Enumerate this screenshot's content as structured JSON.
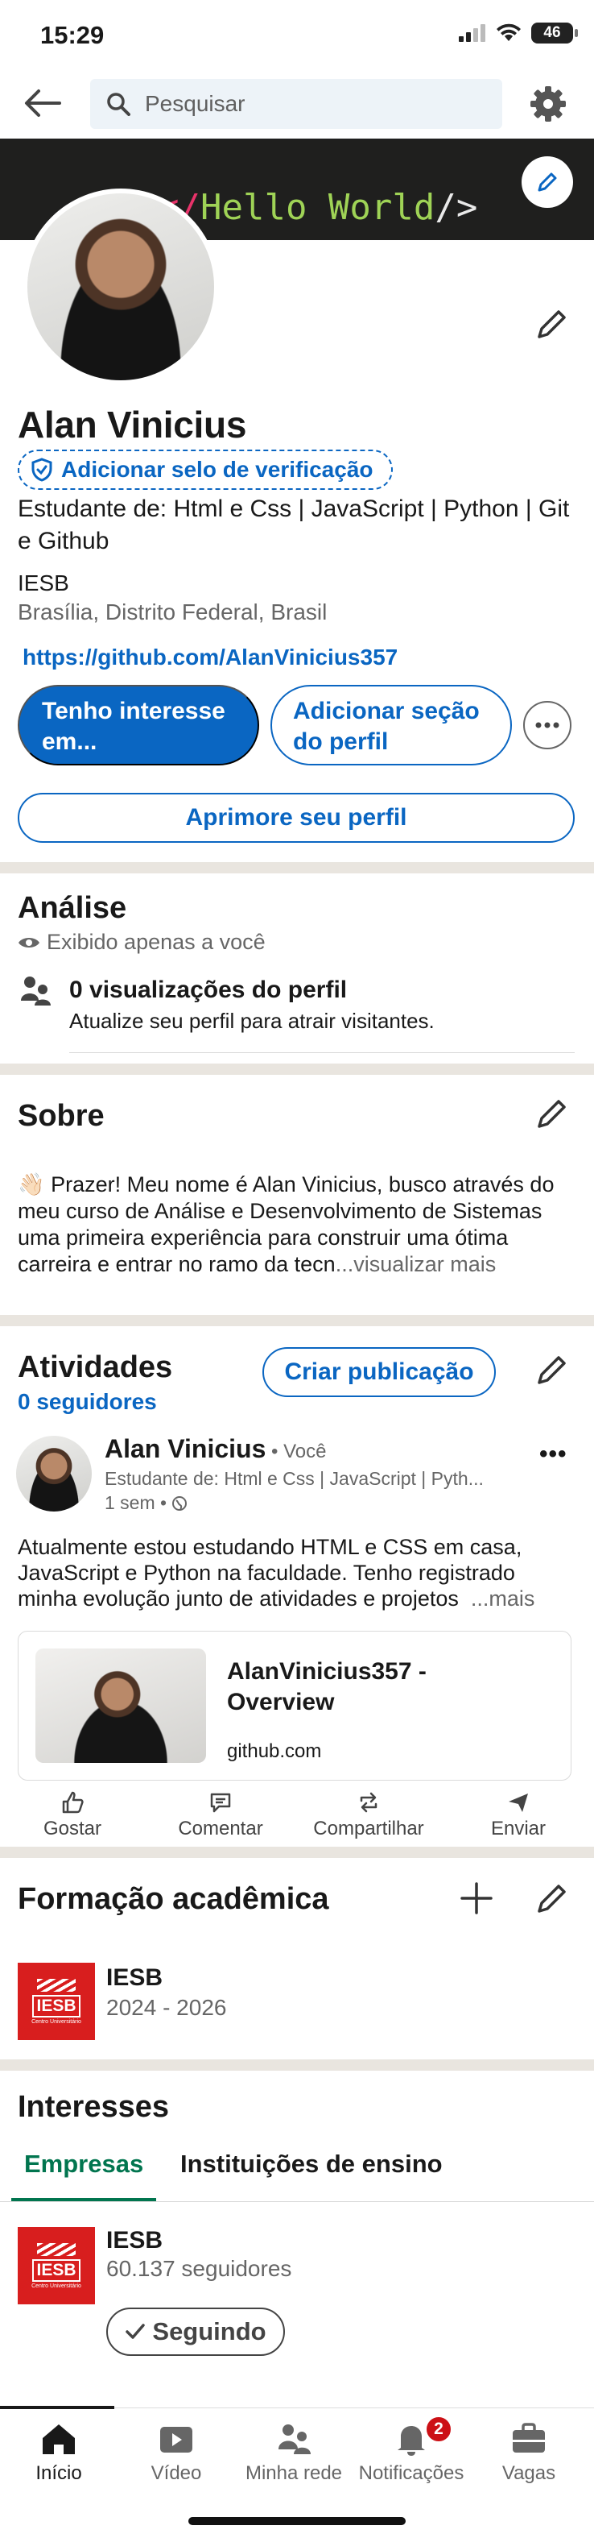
{
  "status_bar": {
    "time": "15:29",
    "battery": "46"
  },
  "top_nav": {
    "search_placeholder": "Pesquisar"
  },
  "cover": {
    "code_open": "</",
    "code_mid": "Hello World",
    "code_close": "/>"
  },
  "profile": {
    "name": "Alan Vinicius",
    "verify_label": "Adicionar selo de verificação",
    "headline": "Estudante de: Html e Css | JavaScript | Python | Git e Github",
    "education": "IESB",
    "location": "Brasília, Distrito Federal, Brasil",
    "link": "https://github.com/AlanVinicius357",
    "open_to_button": "Tenho interesse em...",
    "add_section_button": "Adicionar seção do perfil",
    "enhance_button": "Aprimore seu perfil"
  },
  "analytics": {
    "title": "Análise",
    "private_note": "Exibido apenas a você",
    "views_title": "0 visualizações do perfil",
    "views_desc": "Atualize seu perfil para atrair visitantes."
  },
  "about": {
    "title": "Sobre",
    "text": "👋🏻 Prazer! Meu nome é Alan Vinicius, busco através do meu curso de Análise e Desenvolvimento de Sistemas uma primeira experiência para construir uma ótima carreira e entrar no ramo da tecn",
    "see_more": "...visualizar mais"
  },
  "activity": {
    "title": "Atividades",
    "followers": "0 seguidores",
    "create_post": "Criar publicação",
    "post": {
      "author": "Alan Vinicius",
      "you": " • Você",
      "headline": "Estudante de: Html e Css | JavaScript | Pyth...",
      "time": "1 sem •",
      "text": "Atualmente estou estudando HTML e CSS em casa, JavaScript e Python na faculdade. Tenho registrado minha evolução junto de atividades e projetos",
      "more": "...mais",
      "card_title": "AlanVinicius357 - Overview",
      "card_domain": "github.com",
      "menu": "•••"
    },
    "actions": [
      "Gostar",
      "Comentar",
      "Compartilhar",
      "Enviar"
    ]
  },
  "education": {
    "title": "Formação acadêmica",
    "school": "IESB",
    "years": "2024 - 2026",
    "logo_text": "IESB",
    "logo_sub": "Centro Universitário"
  },
  "interests": {
    "title": "Interesses",
    "tabs": [
      "Empresas",
      "Instituições de ensino"
    ],
    "company": "IESB",
    "company_followers": "60.137 seguidores",
    "following_label": "Seguindo"
  },
  "bottom_nav": {
    "items": [
      "Início",
      "Vídeo",
      "Minha rede",
      "Notificações",
      "Vagas"
    ],
    "notification_count": "2"
  },
  "colors": {
    "brand": "#0a66c2",
    "green": "#01754f",
    "badge": "#cc1016"
  }
}
